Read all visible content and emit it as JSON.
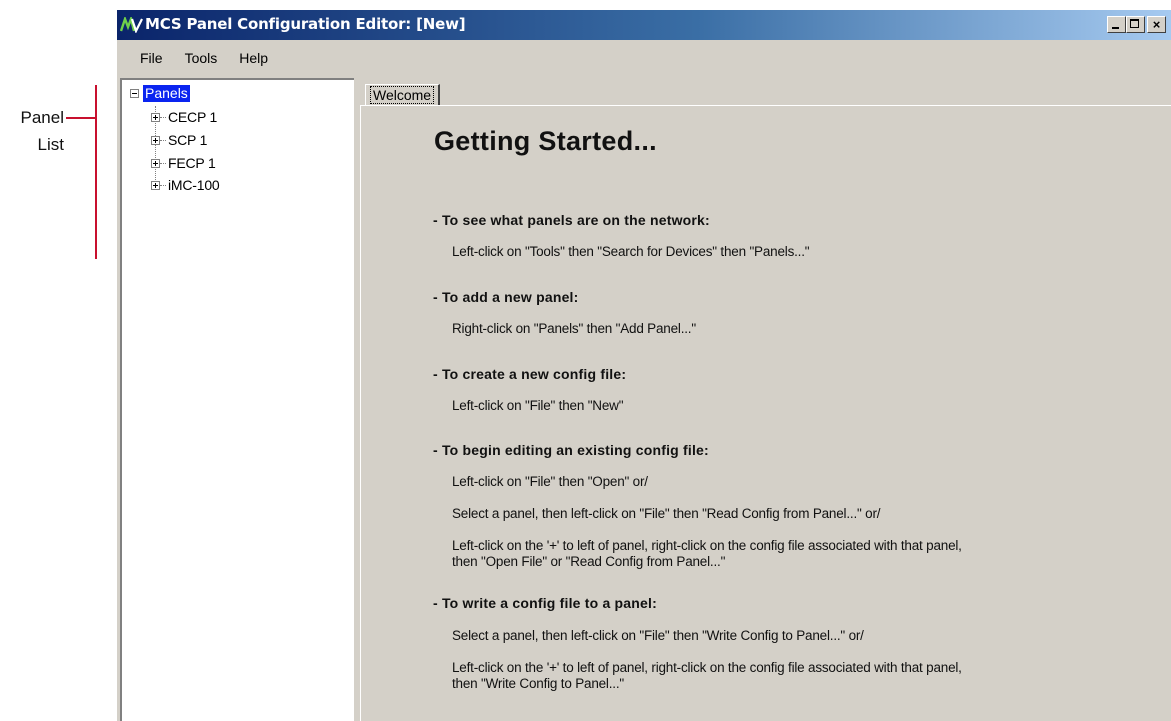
{
  "annotation": {
    "label_line1": "Panel",
    "label_line2": "List",
    "line_color": "#c8102e"
  },
  "window": {
    "title": "MCS Panel Configuration Editor: [New]",
    "icon": "mcs-app-icon",
    "buttons": {
      "minimize": "minimize-icon",
      "maximize": "maximize-icon",
      "close": "close-icon"
    }
  },
  "menu": {
    "items": [
      "File",
      "Tools",
      "Help"
    ]
  },
  "tree": {
    "root": "Panels",
    "children": [
      "CECP 1",
      "SCP 1",
      "FECP 1",
      "iMC-100"
    ]
  },
  "tabs": {
    "active": "Welcome"
  },
  "welcome": {
    "heading": "Getting Started...",
    "sections": [
      {
        "title": "- To see what panels are on the network:",
        "lines": [
          "Left-click on \"Tools\" then \"Search for Devices\" then \"Panels...\""
        ]
      },
      {
        "title": "- To add a new panel:",
        "lines": [
          "Right-click on \"Panels\" then \"Add Panel...\""
        ]
      },
      {
        "title": "- To create a new config file:",
        "lines": [
          "Left-click on \"File\" then \"New\""
        ]
      },
      {
        "title": "- To begin editing an existing config file:",
        "lines": [
          "Left-click on \"File\" then \"Open\"  or/",
          "Select a panel, then left-click on \"File\" then \"Read Config from Panel...\"  or/",
          "Left-click on the '+' to left of panel, right-click on the config file associated with that panel,",
          "then \"Open File\" or \"Read Config from Panel...\""
        ]
      },
      {
        "title": "- To write a config file to a panel:",
        "lines": [
          "Select a panel, then left-click on \"File\" then \"Write Config to Panel...\"  or/",
          "Left-click on the '+' to left of panel, right-click on the config file associated with that panel,",
          "then \"Write Config to Panel...\""
        ]
      }
    ]
  }
}
